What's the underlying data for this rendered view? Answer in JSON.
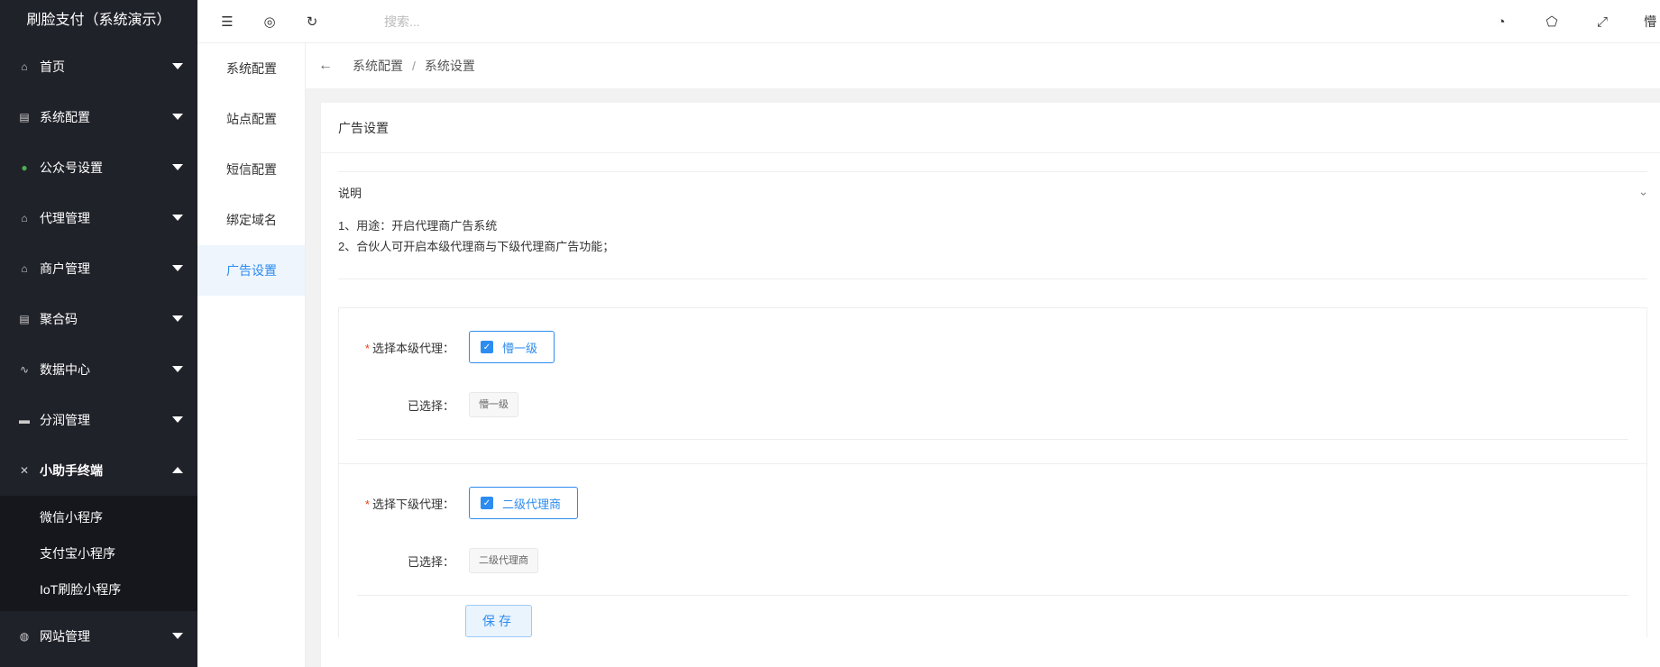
{
  "app": {
    "title": "刷脸支付（系统演示）"
  },
  "sidebar": {
    "items": [
      {
        "label": "首页",
        "icon": "home-icon",
        "glyph": "⌂"
      },
      {
        "label": "系统配置",
        "icon": "book-icon",
        "glyph": "▤"
      },
      {
        "label": "公众号设置",
        "icon": "wechat-icon",
        "glyph": "●"
      },
      {
        "label": "代理管理",
        "icon": "home-icon",
        "glyph": "⌂"
      },
      {
        "label": "商户管理",
        "icon": "home-icon",
        "glyph": "⌂"
      },
      {
        "label": "聚合码",
        "icon": "book-icon",
        "glyph": "▤"
      },
      {
        "label": "数据中心",
        "icon": "pulse-icon",
        "glyph": "∿"
      },
      {
        "label": "分润管理",
        "icon": "monitor-icon",
        "glyph": "▬"
      },
      {
        "label": "小助手终端",
        "icon": "tools-icon",
        "glyph": "✕"
      },
      {
        "label": "网站管理",
        "icon": "globe-icon",
        "glyph": "◍"
      }
    ],
    "sub_items": [
      "微信小程序",
      "支付宝小程序",
      "IoT刷脸小程序"
    ]
  },
  "secondary_menu": [
    "系统配置",
    "站点配置",
    "短信配置",
    "绑定域名",
    "广告设置"
  ],
  "header": {
    "search_placeholder": "搜索...",
    "user_initial": "懵"
  },
  "breadcrumb": {
    "parent": "系统配置",
    "current": "系统设置",
    "separator": "/"
  },
  "card": {
    "title": "广告设置",
    "collapse_title": "说明",
    "notes": [
      "1、用途：开启代理商广告系统",
      "2、合伙人可开启本级代理商与下级代理商广告功能；"
    ]
  },
  "form": {
    "level_label": "选择本级代理：",
    "level_option": "懵一级",
    "level_selected_label": "已选择：",
    "level_selected_tag": "懵一级",
    "sub_label": "选择下级代理：",
    "sub_option": "二级代理商",
    "sub_selected_label": "已选择：",
    "sub_selected_tag": "二级代理商",
    "required_mark": "*",
    "save_label": "保存"
  },
  "colors": {
    "accent": "#2d8cf0",
    "sidebar_bg": "#20222a",
    "submenu_bg": "#16171c",
    "required": "#ed4014"
  }
}
